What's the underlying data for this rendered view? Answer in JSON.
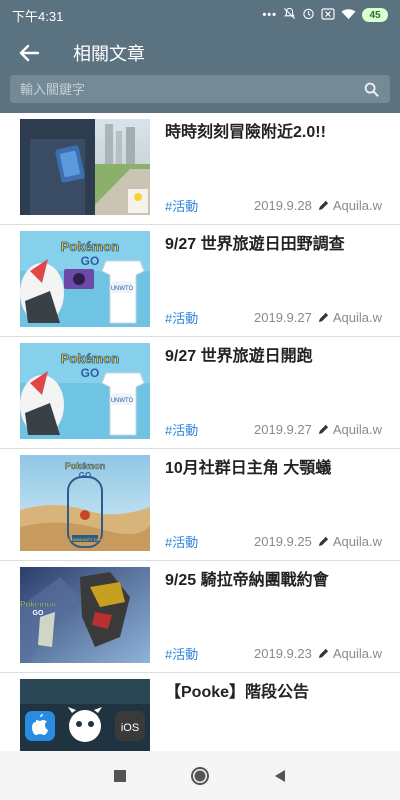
{
  "status_bar": {
    "time": "下午4:31",
    "battery": "45"
  },
  "app_bar": {
    "title": "相關文章"
  },
  "search": {
    "placeholder": "輸入關鍵字"
  },
  "articles": [
    {
      "title": "時時刻刻冒險附近2.0!!",
      "tag": "#活動",
      "date": "2019.9.28",
      "author": "Aquila.w"
    },
    {
      "title": "9/27 世界旅遊日田野調查",
      "tag": "#活動",
      "date": "2019.9.27",
      "author": "Aquila.w"
    },
    {
      "title": "9/27 世界旅遊日開跑",
      "tag": "#活動",
      "date": "2019.9.27",
      "author": "Aquila.w"
    },
    {
      "title": "10月社群日主角 大顎蟻",
      "tag": "#活動",
      "date": "2019.9.25",
      "author": "Aquila.w"
    },
    {
      "title": "9/25 騎拉帝納團戰約會",
      "tag": "#活動",
      "date": "2019.9.23",
      "author": "Aquila.w"
    },
    {
      "title": "【Pooke】階段公告",
      "tag": "",
      "date": "",
      "author": ""
    }
  ],
  "thumbnails": {
    "pokemon_logo_top": "Pokémon",
    "pokemon_logo_bottom": "GO",
    "unwto_shirt_text": "UNWTO",
    "community_day_text": "COMMUNITY DAY",
    "ios_text": "iOS"
  },
  "colors": {
    "app_bar": "#5b7280",
    "tag": "#2b86d9",
    "meta_gray": "#8a8a8a"
  }
}
